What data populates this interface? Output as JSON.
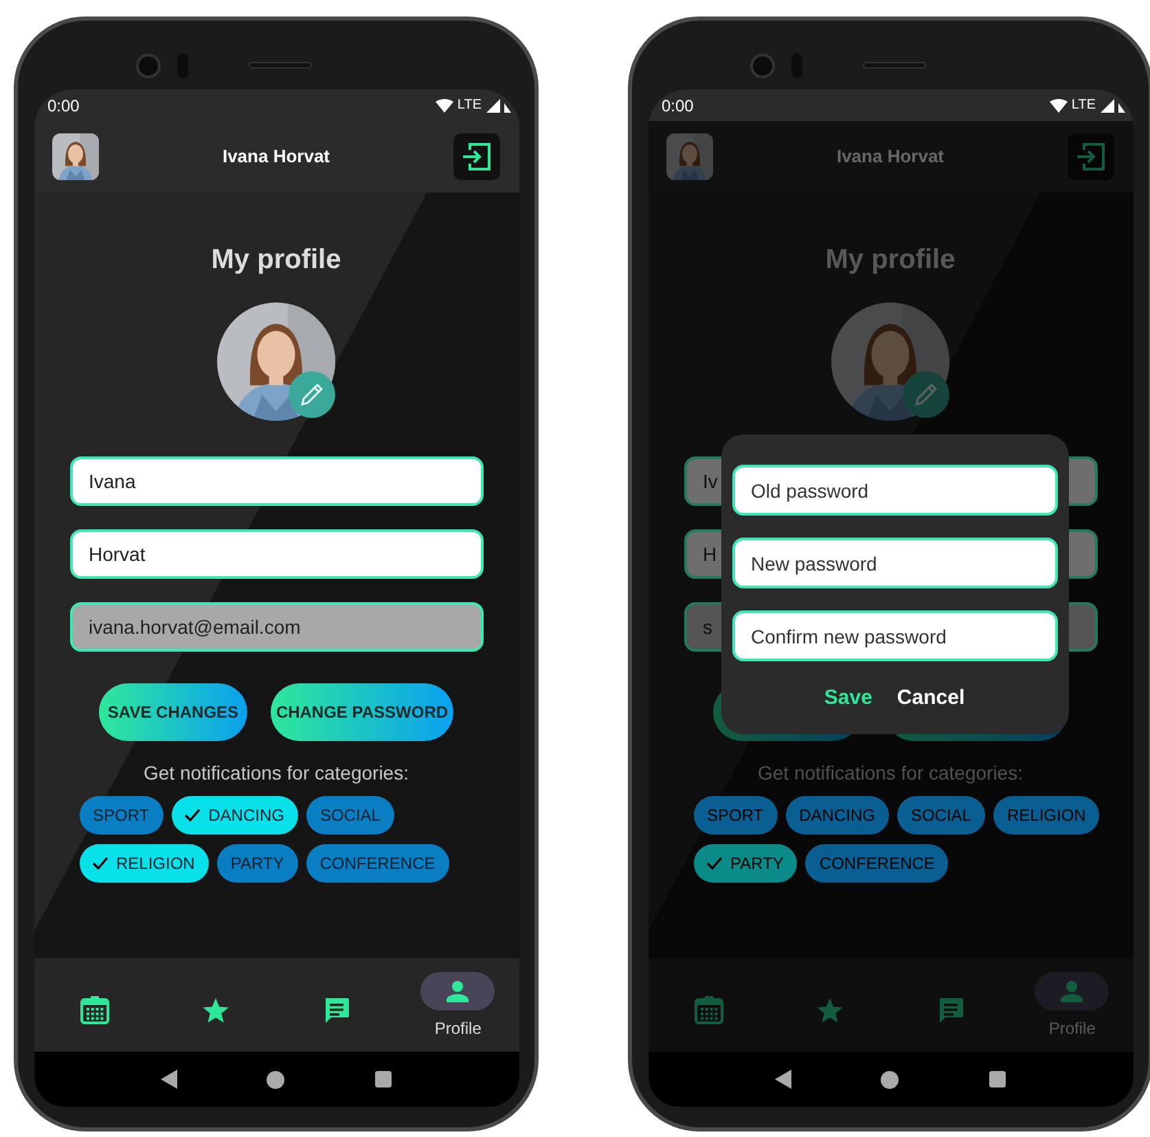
{
  "phones": [
    {
      "status_bar": {
        "time": "0:00",
        "network": "LTE"
      },
      "app_bar": {
        "title": "Ivana Horvat"
      },
      "heading": "My profile",
      "fields": [
        {
          "value": "Ivana",
          "disabled": false
        },
        {
          "value": "Horvat",
          "disabled": false
        },
        {
          "value": "ivana.horvat@email.com",
          "disabled": true
        }
      ],
      "buttons": [
        {
          "label": "SAVE CHANGES"
        },
        {
          "label": "CHANGE PASSWORD"
        }
      ],
      "notifications_label": "Get notifications for categories:",
      "categories": [
        {
          "label": "SPORT",
          "selected": false
        },
        {
          "label": "DANCING",
          "selected": true
        },
        {
          "label": "SOCIAL",
          "selected": false
        },
        {
          "label": "RELIGION",
          "selected": true
        },
        {
          "label": "PARTY",
          "selected": false
        },
        {
          "label": "CONFERENCE",
          "selected": false
        }
      ],
      "nav": [
        {
          "kind": "calendar",
          "selected": false
        },
        {
          "kind": "star",
          "selected": false
        },
        {
          "kind": "chat",
          "selected": false
        },
        {
          "kind": "person",
          "label": "Profile",
          "selected": true
        }
      ]
    },
    {
      "status_bar": {
        "time": "0:00",
        "network": "LTE"
      },
      "app_bar": {
        "title": "Ivana Horvat"
      },
      "heading": "My profile",
      "fields": [
        {
          "value": "Iv",
          "disabled": false
        },
        {
          "value": "H",
          "disabled": false
        },
        {
          "value": "s",
          "disabled": true
        }
      ],
      "notifications_label": "Get notifications for categories:",
      "categories": [
        {
          "label": "SPORT",
          "selected": false
        },
        {
          "label": "DANCING",
          "selected": false
        },
        {
          "label": "SOCIAL",
          "selected": false
        },
        {
          "label": "RELIGION",
          "selected": false
        },
        {
          "label": "PARTY",
          "selected": true
        },
        {
          "label": "CONFERENCE",
          "selected": false
        }
      ],
      "nav": [
        {
          "kind": "calendar",
          "selected": false
        },
        {
          "kind": "star",
          "selected": false
        },
        {
          "kind": "chat",
          "selected": false
        },
        {
          "kind": "person",
          "label": "Profile",
          "selected": true
        }
      ],
      "dialog": {
        "fields": [
          {
            "placeholder": "Old password"
          },
          {
            "placeholder": "New password"
          },
          {
            "placeholder": "Confirm new password"
          }
        ],
        "actions": [
          {
            "label": "Save",
            "kind": "primary"
          },
          {
            "label": "Cancel",
            "kind": "secondary"
          }
        ]
      }
    }
  ]
}
